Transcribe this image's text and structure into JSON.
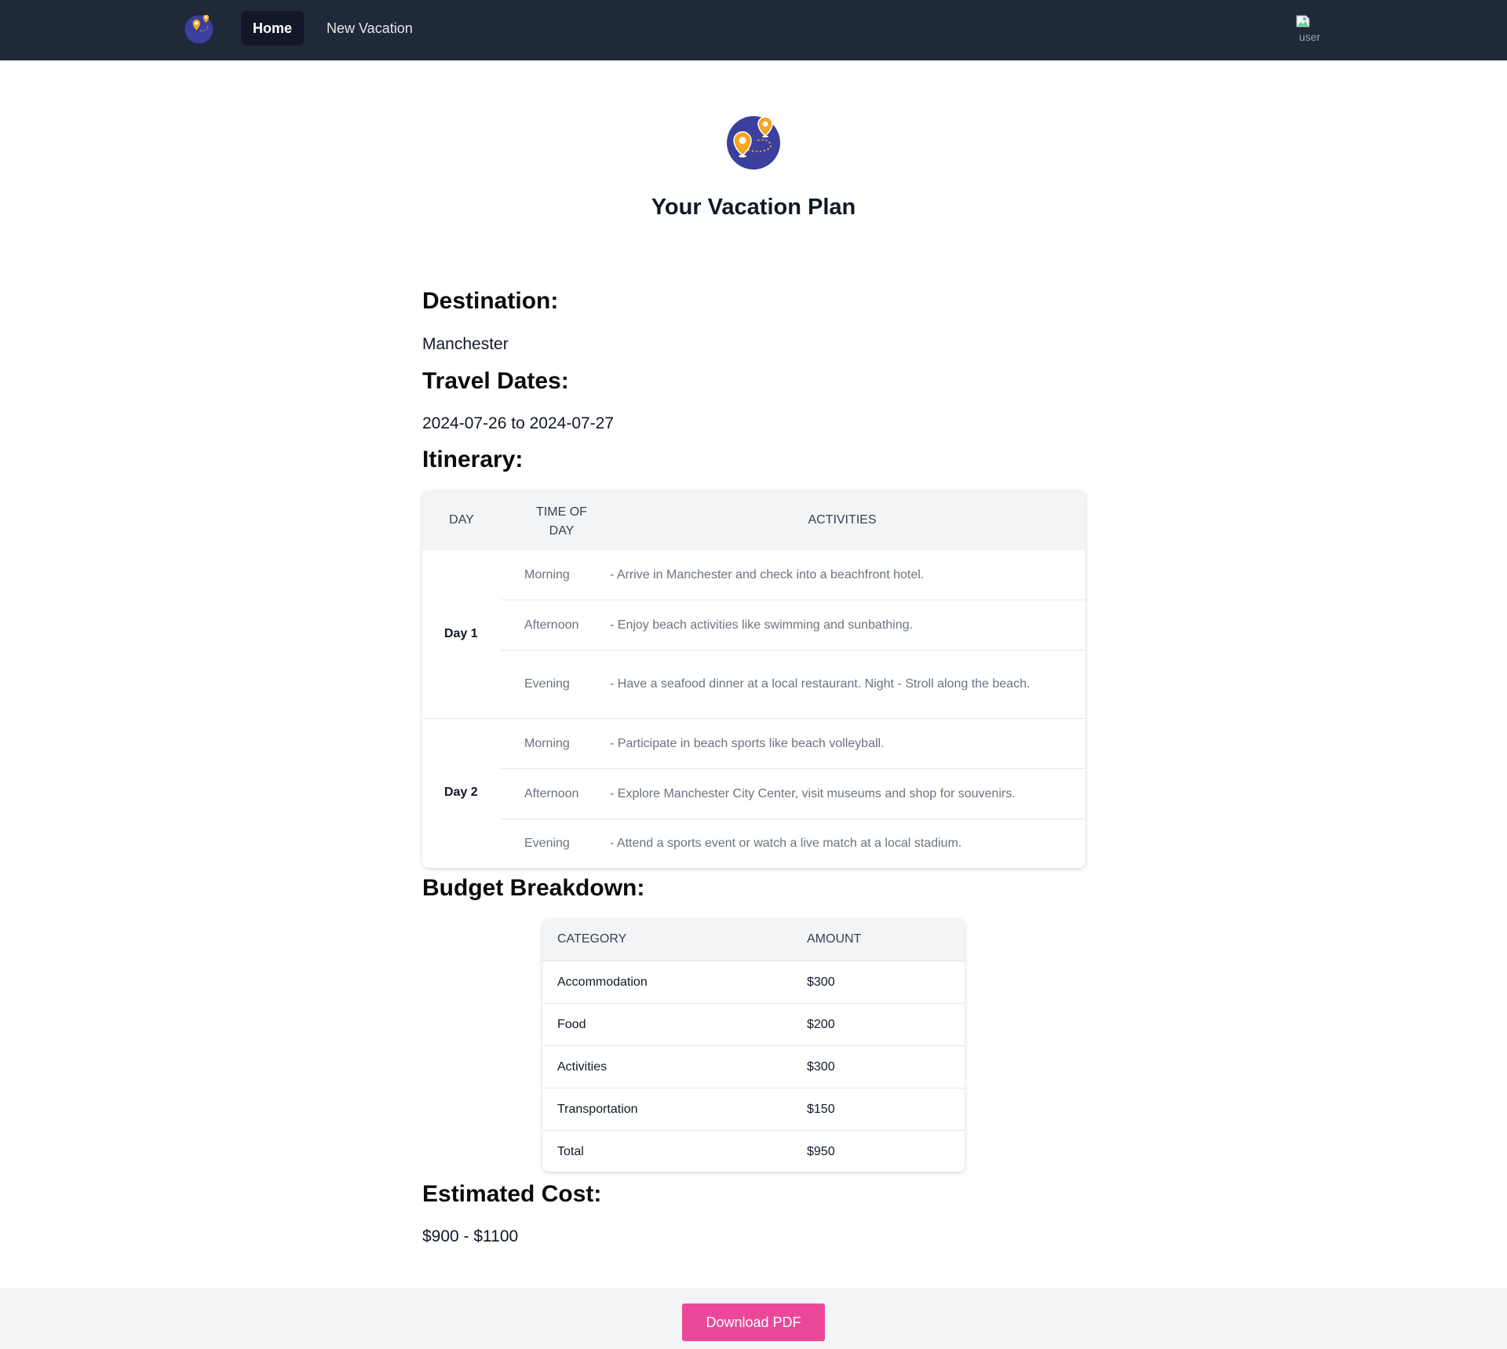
{
  "nav": {
    "logo_icon": "map-pins-logo-icon",
    "links": [
      {
        "label": "Home",
        "active": true
      },
      {
        "label": "New Vacation",
        "active": false
      }
    ],
    "avatar_alt": "user"
  },
  "header": {
    "title": "Your Vacation Plan"
  },
  "destination": {
    "heading": "Destination:",
    "value": "Manchester"
  },
  "travel_dates": {
    "heading": "Travel Dates:",
    "value": "2024-07-26 to 2024-07-27"
  },
  "itinerary": {
    "heading": "Itinerary:",
    "columns": [
      "Day",
      "Time of Day",
      "Activities"
    ],
    "days": [
      {
        "day": "Day 1",
        "slots": [
          {
            "time": "Morning",
            "activity": "- Arrive in Manchester and check into a beachfront hotel."
          },
          {
            "time": "Afternoon",
            "activity": "- Enjoy beach activities like swimming and sunbathing."
          },
          {
            "time": "Evening",
            "activity": "- Have a seafood dinner at a local restaurant. Night - Stroll along the beach."
          }
        ]
      },
      {
        "day": "Day 2",
        "slots": [
          {
            "time": "Morning",
            "activity": "- Participate in beach sports like beach volleyball."
          },
          {
            "time": "Afternoon",
            "activity": "- Explore Manchester City Center, visit museums and shop for souvenirs."
          },
          {
            "time": "Evening",
            "activity": "- Attend a sports event or watch a live match at a local stadium."
          }
        ]
      }
    ]
  },
  "budget": {
    "heading": "Budget Breakdown:",
    "columns": [
      "Category",
      "Amount"
    ],
    "rows": [
      {
        "category": "Accommodation",
        "amount": "$300"
      },
      {
        "category": "Food",
        "amount": "$200"
      },
      {
        "category": "Activities",
        "amount": "$300"
      },
      {
        "category": "Transportation",
        "amount": "$150"
      },
      {
        "category": "Total",
        "amount": "$950"
      }
    ]
  },
  "estimated_cost": {
    "heading": "Estimated Cost:",
    "value": "$900 - $1100"
  },
  "footer": {
    "download_label": "Download PDF"
  },
  "colors": {
    "nav_bg": "#1f2937",
    "brand_circle": "#3b3f9e",
    "pin_orange": "#f5a623",
    "download_button": "#ec4899"
  }
}
